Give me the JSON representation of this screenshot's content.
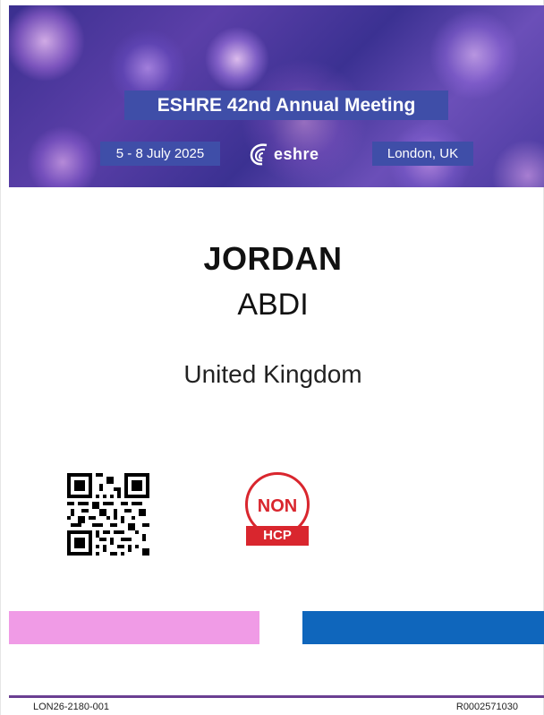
{
  "banner": {
    "title": "ESHRE 42nd Annual Meeting",
    "date": "5 - 8 July 2025",
    "logo_text": "eshre",
    "location": "London, UK"
  },
  "attendee": {
    "first_name": "JORDAN",
    "last_name": "ABDI",
    "country": "United Kingdom"
  },
  "badge": {
    "line1": "NON",
    "line2": "HCP",
    "color": "#d9262e"
  },
  "icons": {
    "qr": "qr-code-icon",
    "logo": "eshre-logo-icon"
  },
  "bars": {
    "left_color": "#f09be6",
    "right_color": "#0f66bc"
  },
  "footer": {
    "left_code": "LON26-2180-001",
    "right_code": "R0002571030"
  }
}
